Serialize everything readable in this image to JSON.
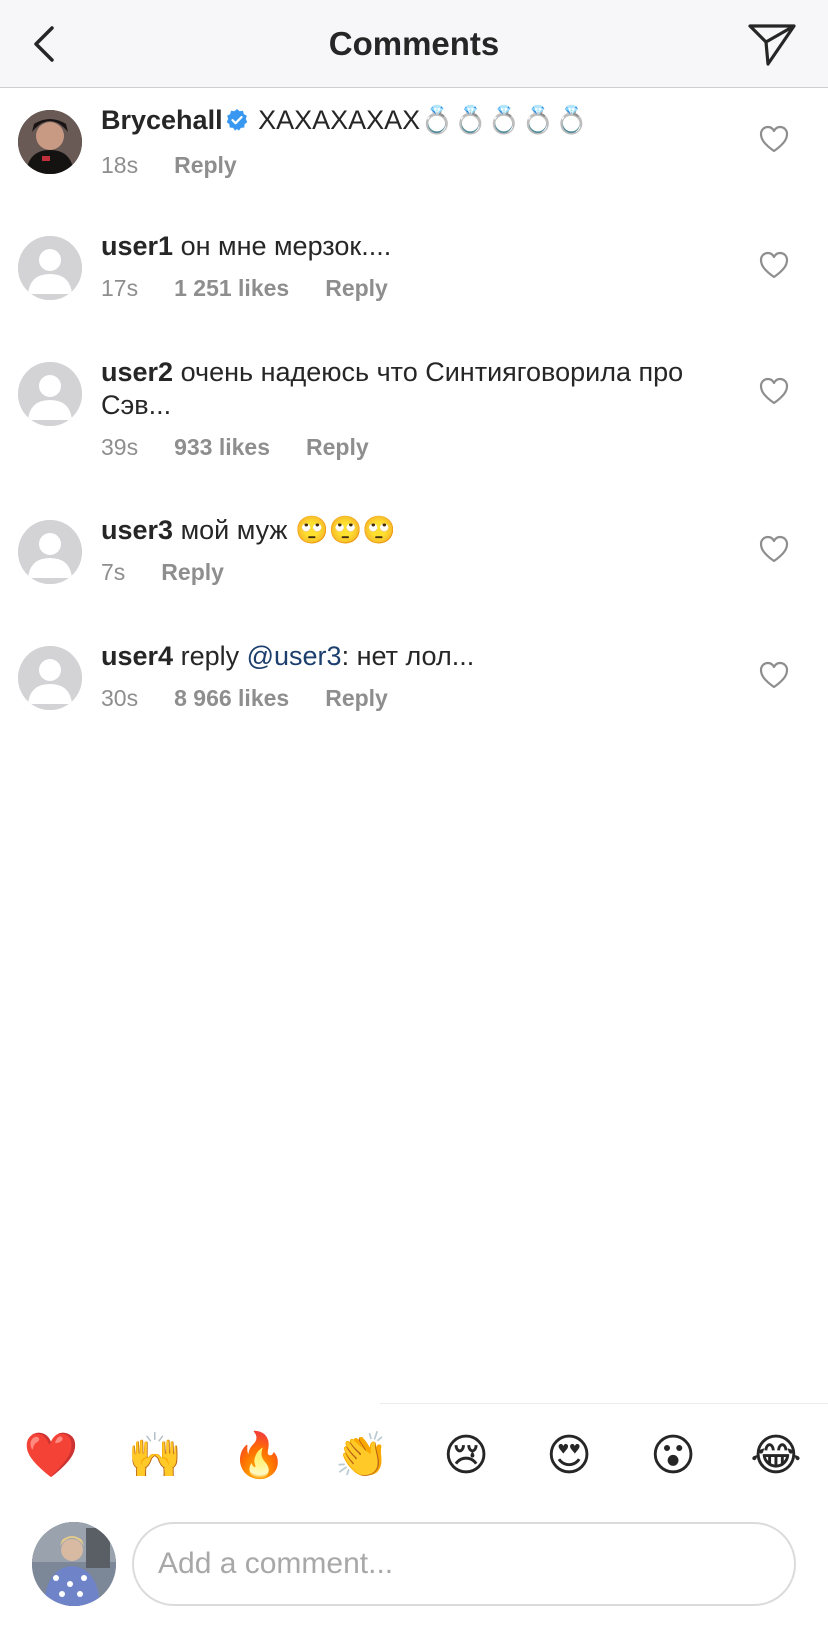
{
  "header": {
    "title": "Comments",
    "back_icon": "chevron-left-icon",
    "send_icon": "paper-plane-icon"
  },
  "comments": [
    {
      "username": "Brycehall",
      "verified": true,
      "text": "ХАХАХАХАХ💍💍💍💍💍",
      "time": "18s",
      "likes": "",
      "reply": "Reply"
    },
    {
      "username": "user1",
      "verified": false,
      "text": "он мне мерзок....",
      "time": "17s",
      "likes": "1 251 likes",
      "reply": "Reply"
    },
    {
      "username": "user2",
      "verified": false,
      "text": "очень надеюсь что Синтияговорила про Сэв...",
      "time": "39s",
      "likes": "933 likes",
      "reply": "Reply"
    },
    {
      "username": "user3",
      "verified": false,
      "text": "мой муж 🙄🙄🙄",
      "time": "7s",
      "likes": "",
      "reply": "Reply"
    },
    {
      "username": "user4",
      "verified": false,
      "text_prefix": "reply ",
      "mention": "@user3",
      "text_suffix": ": нет лол...",
      "time": "30s",
      "likes": "8 966 likes",
      "reply": "Reply"
    }
  ],
  "emoji_bar": [
    "❤️",
    "🙌",
    "🔥",
    "👏",
    "😢",
    "😍",
    "😮",
    "😂"
  ],
  "composer": {
    "placeholder": "Add a comment..."
  },
  "colors": {
    "verified": "#3897f0",
    "secondary_text": "#8e8e8e",
    "mention": "#1c3f6e"
  }
}
